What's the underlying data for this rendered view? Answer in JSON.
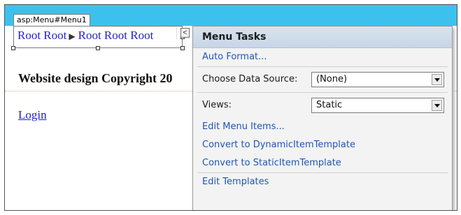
{
  "designer": {
    "control_tag": "asp:Menu#Menu1",
    "menu_items": [
      "Root Root",
      "Root Root Root"
    ],
    "menu_separator": "▶",
    "smart_tag_glyph": "<",
    "copyright_text": "Website design Copyright 20",
    "login_link": "Login",
    "topbar_color": "#3cc1ee"
  },
  "menu_tasks": {
    "title": "Menu Tasks",
    "auto_format": "Auto Format...",
    "choose_data_source_label": "Choose Data Source:",
    "choose_data_source_value": "(None)",
    "views_label": "Views:",
    "views_value": "Static",
    "edit_menu_items": "Edit Menu Items...",
    "convert_dynamic": "Convert to DynamicItemTemplate",
    "convert_static": "Convert to StaticItemTemplate",
    "edit_templates": "Edit Templates",
    "link_color": "#1f55b8"
  }
}
